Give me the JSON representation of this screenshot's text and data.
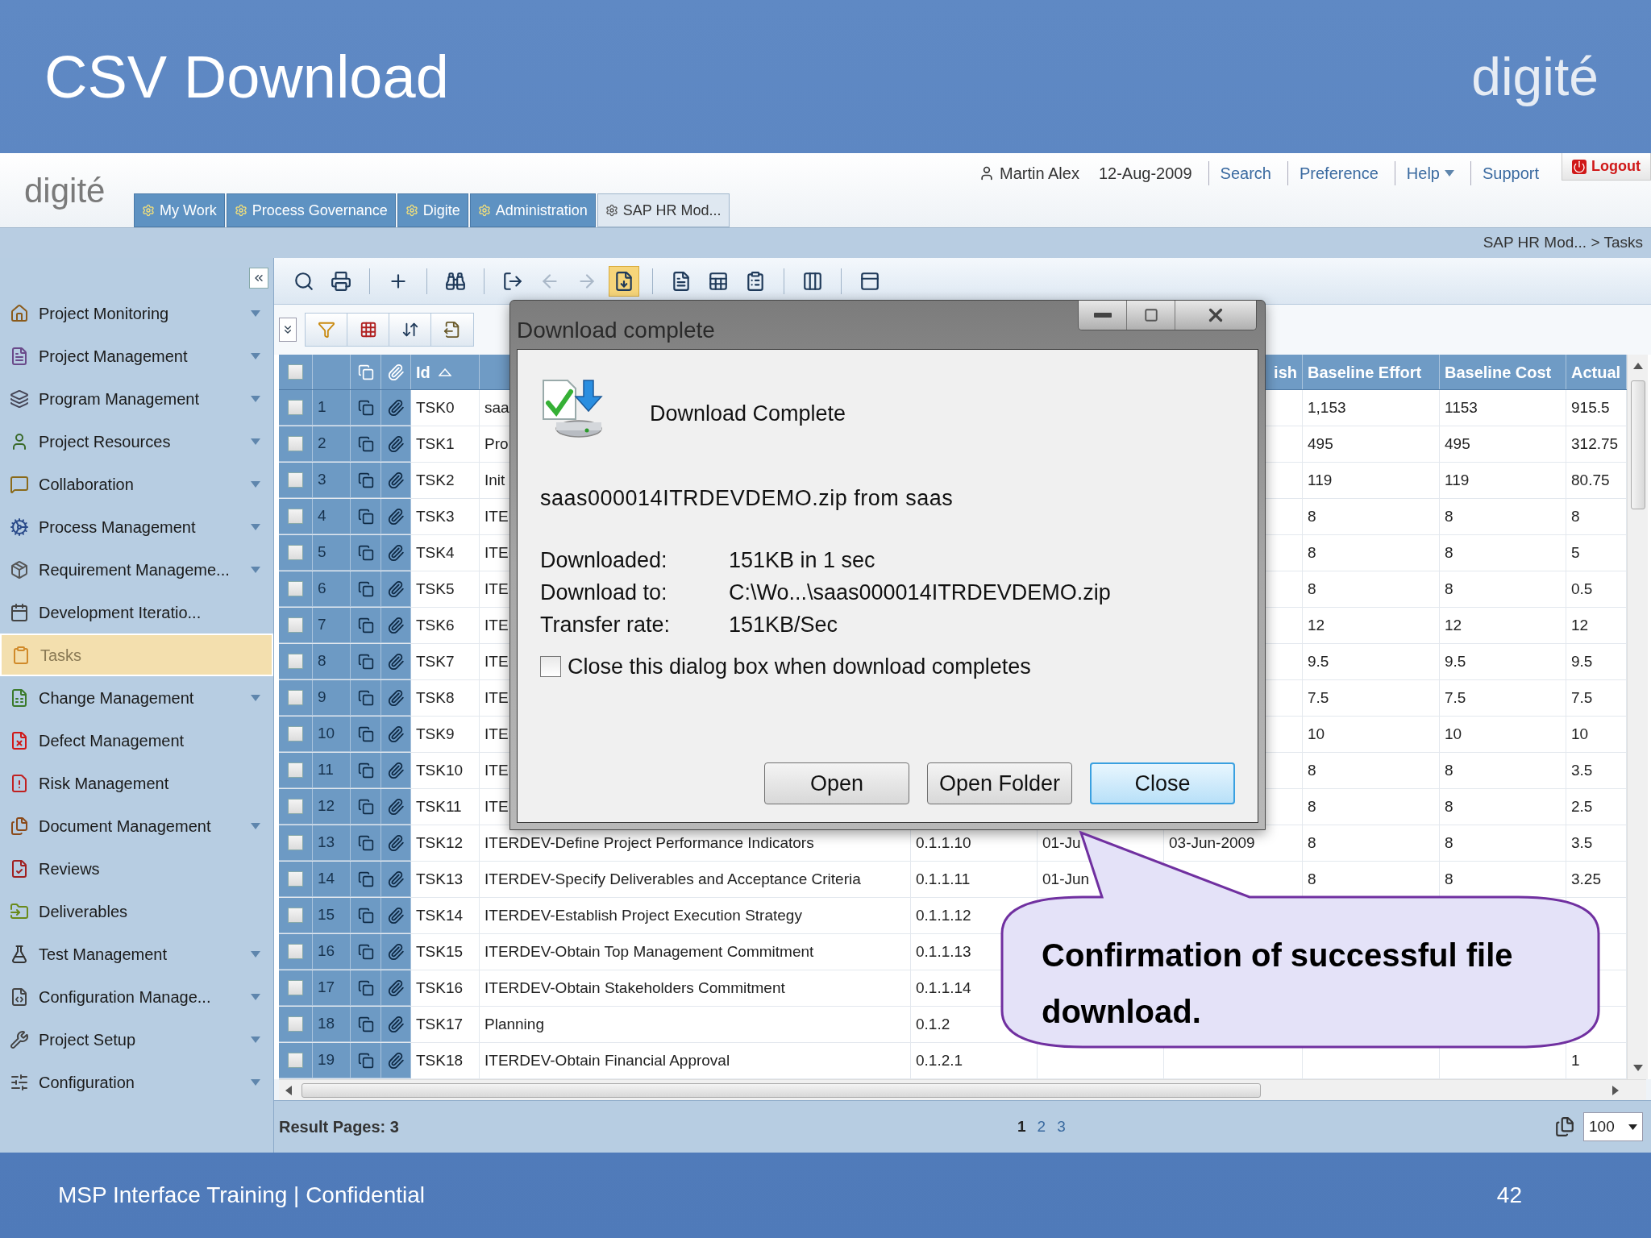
{
  "slide": {
    "title": "CSV Download",
    "logo": "digité",
    "footer": "MSP Interface Training | Confidential",
    "page_number": "42"
  },
  "app": {
    "logo": "digité",
    "tabs": [
      {
        "label": "My Work",
        "selected": false
      },
      {
        "label": "Process Governance",
        "selected": false
      },
      {
        "label": "Digite",
        "selected": false
      },
      {
        "label": "Administration",
        "selected": false
      },
      {
        "label": "SAP HR Mod...",
        "selected": true
      }
    ],
    "user": "Martin Alex",
    "date": "12-Aug-2009",
    "links": [
      {
        "label": "Search",
        "has_menu": false
      },
      {
        "label": "Preference",
        "has_menu": false
      },
      {
        "label": "Help",
        "has_menu": true
      },
      {
        "label": "Support",
        "has_menu": false
      }
    ],
    "logout": "Logout",
    "breadcrumb": "SAP HR Mod... > Tasks",
    "sidebar": [
      {
        "label": "Project Monitoring",
        "has_menu": true,
        "selected": false
      },
      {
        "label": "Project Management",
        "has_menu": true,
        "selected": false
      },
      {
        "label": "Program Management",
        "has_menu": true,
        "selected": false
      },
      {
        "label": "Project Resources",
        "has_menu": true,
        "selected": false
      },
      {
        "label": "Collaboration",
        "has_menu": true,
        "selected": false
      },
      {
        "label": "Process Management",
        "has_menu": true,
        "selected": false
      },
      {
        "label": "Requirement Manageme...",
        "has_menu": true,
        "selected": false
      },
      {
        "label": "Development Iteratio...",
        "has_menu": false,
        "selected": false
      },
      {
        "label": "Tasks",
        "has_menu": false,
        "selected": true
      },
      {
        "label": "Change Management",
        "has_menu": true,
        "selected": false
      },
      {
        "label": "Defect Management",
        "has_menu": false,
        "selected": false
      },
      {
        "label": "Risk Management",
        "has_menu": false,
        "selected": false
      },
      {
        "label": "Document Management",
        "has_menu": true,
        "selected": false
      },
      {
        "label": "Reviews",
        "has_menu": false,
        "selected": false
      },
      {
        "label": "Deliverables",
        "has_menu": false,
        "selected": false
      },
      {
        "label": "Test Management",
        "has_menu": true,
        "selected": false
      },
      {
        "label": "Configuration Manage...",
        "has_menu": true,
        "selected": false
      },
      {
        "label": "Project Setup",
        "has_menu": true,
        "selected": false
      },
      {
        "label": "Configuration",
        "has_menu": true,
        "selected": false
      }
    ],
    "toolbar": [
      {
        "disabled": false,
        "active": false
      },
      {
        "disabled": false,
        "active": false
      },
      {
        "disabled": false,
        "active": false
      },
      {
        "disabled": false,
        "active": false
      },
      {
        "disabled": false,
        "active": false
      },
      {
        "disabled": true,
        "active": false
      },
      {
        "disabled": true,
        "active": false
      },
      {
        "disabled": false,
        "active": true
      },
      {
        "disabled": false,
        "active": false
      },
      {
        "disabled": false,
        "active": false
      },
      {
        "disabled": false,
        "active": false
      },
      {
        "disabled": false,
        "active": false
      },
      {
        "disabled": false,
        "active": false
      }
    ],
    "table": {
      "header": {
        "checked": false,
        "id": "Id",
        "sort_ascending": true,
        "finish": "ish",
        "baseline_effort": "Baseline Effort",
        "baseline_cost": "Baseline Cost",
        "actual": "Actual"
      },
      "rows": [
        {
          "number": "1",
          "checked": false,
          "id": "TSK0",
          "name": "saa",
          "baseline_effort": "1,153",
          "baseline_cost": "1153",
          "actual": "915.5"
        },
        {
          "number": "2",
          "checked": false,
          "id": "TSK1",
          "name": "Pro",
          "baseline_effort": "495",
          "baseline_cost": "495",
          "actual": "312.75"
        },
        {
          "number": "3",
          "checked": false,
          "id": "TSK2",
          "name": "Init",
          "baseline_effort": "119",
          "baseline_cost": "119",
          "actual": "80.75"
        },
        {
          "number": "4",
          "checked": false,
          "id": "TSK3",
          "name": "ITE",
          "baseline_effort": "8",
          "baseline_cost": "8",
          "actual": "8"
        },
        {
          "number": "5",
          "checked": false,
          "id": "TSK4",
          "name": "ITE",
          "baseline_effort": "8",
          "baseline_cost": "8",
          "actual": "5"
        },
        {
          "number": "6",
          "checked": false,
          "id": "TSK5",
          "name": "ITE",
          "baseline_effort": "8",
          "baseline_cost": "8",
          "actual": "0.5"
        },
        {
          "number": "7",
          "checked": false,
          "id": "TSK6",
          "name": "ITE",
          "baseline_effort": "12",
          "baseline_cost": "12",
          "actual": "12"
        },
        {
          "number": "8",
          "checked": false,
          "id": "TSK7",
          "name": "ITE",
          "baseline_effort": "9.5",
          "baseline_cost": "9.5",
          "actual": "9.5"
        },
        {
          "number": "9",
          "checked": false,
          "id": "TSK8",
          "name": "ITE",
          "baseline_effort": "7.5",
          "baseline_cost": "7.5",
          "actual": "7.5"
        },
        {
          "number": "10",
          "checked": false,
          "id": "TSK9",
          "name": "ITE",
          "baseline_effort": "10",
          "baseline_cost": "10",
          "actual": "10"
        },
        {
          "number": "11",
          "checked": false,
          "id": "TSK10",
          "name": "ITE",
          "baseline_effort": "8",
          "baseline_cost": "8",
          "actual": "3.5"
        },
        {
          "number": "12",
          "checked": false,
          "id": "TSK11",
          "name": "ITE",
          "baseline_effort": "8",
          "baseline_cost": "8",
          "actual": "2.5"
        },
        {
          "number": "13",
          "checked": false,
          "id": "TSK12",
          "name": "ITERDEV-Define Project Performance Indicators",
          "wbs": "0.1.1.10",
          "start": "01-Ju",
          "finish": "03-Jun-2009",
          "baseline_effort": "8",
          "baseline_cost": "8",
          "actual": "3.5"
        },
        {
          "number": "14",
          "checked": false,
          "id": "TSK13",
          "name": "ITERDEV-Specify Deliverables and Acceptance Criteria",
          "wbs": "0.1.1.11",
          "start": "01-Jun",
          "baseline_effort": "8",
          "baseline_cost": "8",
          "actual": "3.25"
        },
        {
          "number": "15",
          "checked": false,
          "id": "TSK14",
          "name": "ITERDEV-Establish Project Execution Strategy",
          "wbs": "0.1.1.12"
        },
        {
          "number": "16",
          "checked": false,
          "id": "TSK15",
          "name": "ITERDEV-Obtain Top Management Commitment",
          "wbs": "0.1.1.13"
        },
        {
          "number": "17",
          "checked": false,
          "id": "TSK16",
          "name": "ITERDEV-Obtain Stakeholders Commitment",
          "wbs": "0.1.1.14"
        },
        {
          "number": "18",
          "checked": false,
          "id": "TSK17",
          "name": "Planning",
          "wbs": "0.1.2"
        },
        {
          "number": "19",
          "checked": false,
          "id": "TSK18",
          "name": "ITERDEV-Obtain Financial Approval",
          "wbs": "0.1.2.1",
          "actual": "1"
        }
      ]
    },
    "result_pages": {
      "label": "Result Pages: 3",
      "pages": [
        {
          "label": "1",
          "selected": true
        },
        {
          "label": "2",
          "selected": false
        },
        {
          "label": "3",
          "selected": false
        }
      ],
      "page_size": "100"
    }
  },
  "dialog": {
    "title": "Download complete",
    "heading": "Download Complete",
    "file": "saas000014ITRDEVDEMO.zip from saas",
    "details": [
      {
        "label": "Downloaded:",
        "value": "151KB in 1 sec"
      },
      {
        "label": "Download to:",
        "value": "C:\\Wo...\\saas000014ITRDEVDEMO.zip"
      },
      {
        "label": "Transfer rate:",
        "value": "151KB/Sec"
      }
    ],
    "close_when_done": {
      "label": "Close this dialog box when download completes",
      "checked": false
    },
    "buttons": [
      {
        "label": "Open",
        "default": false
      },
      {
        "label": "Open Folder",
        "default": false
      },
      {
        "label": "Close",
        "default": true
      }
    ]
  },
  "callout": {
    "text": "Confirmation of successful file download."
  }
}
